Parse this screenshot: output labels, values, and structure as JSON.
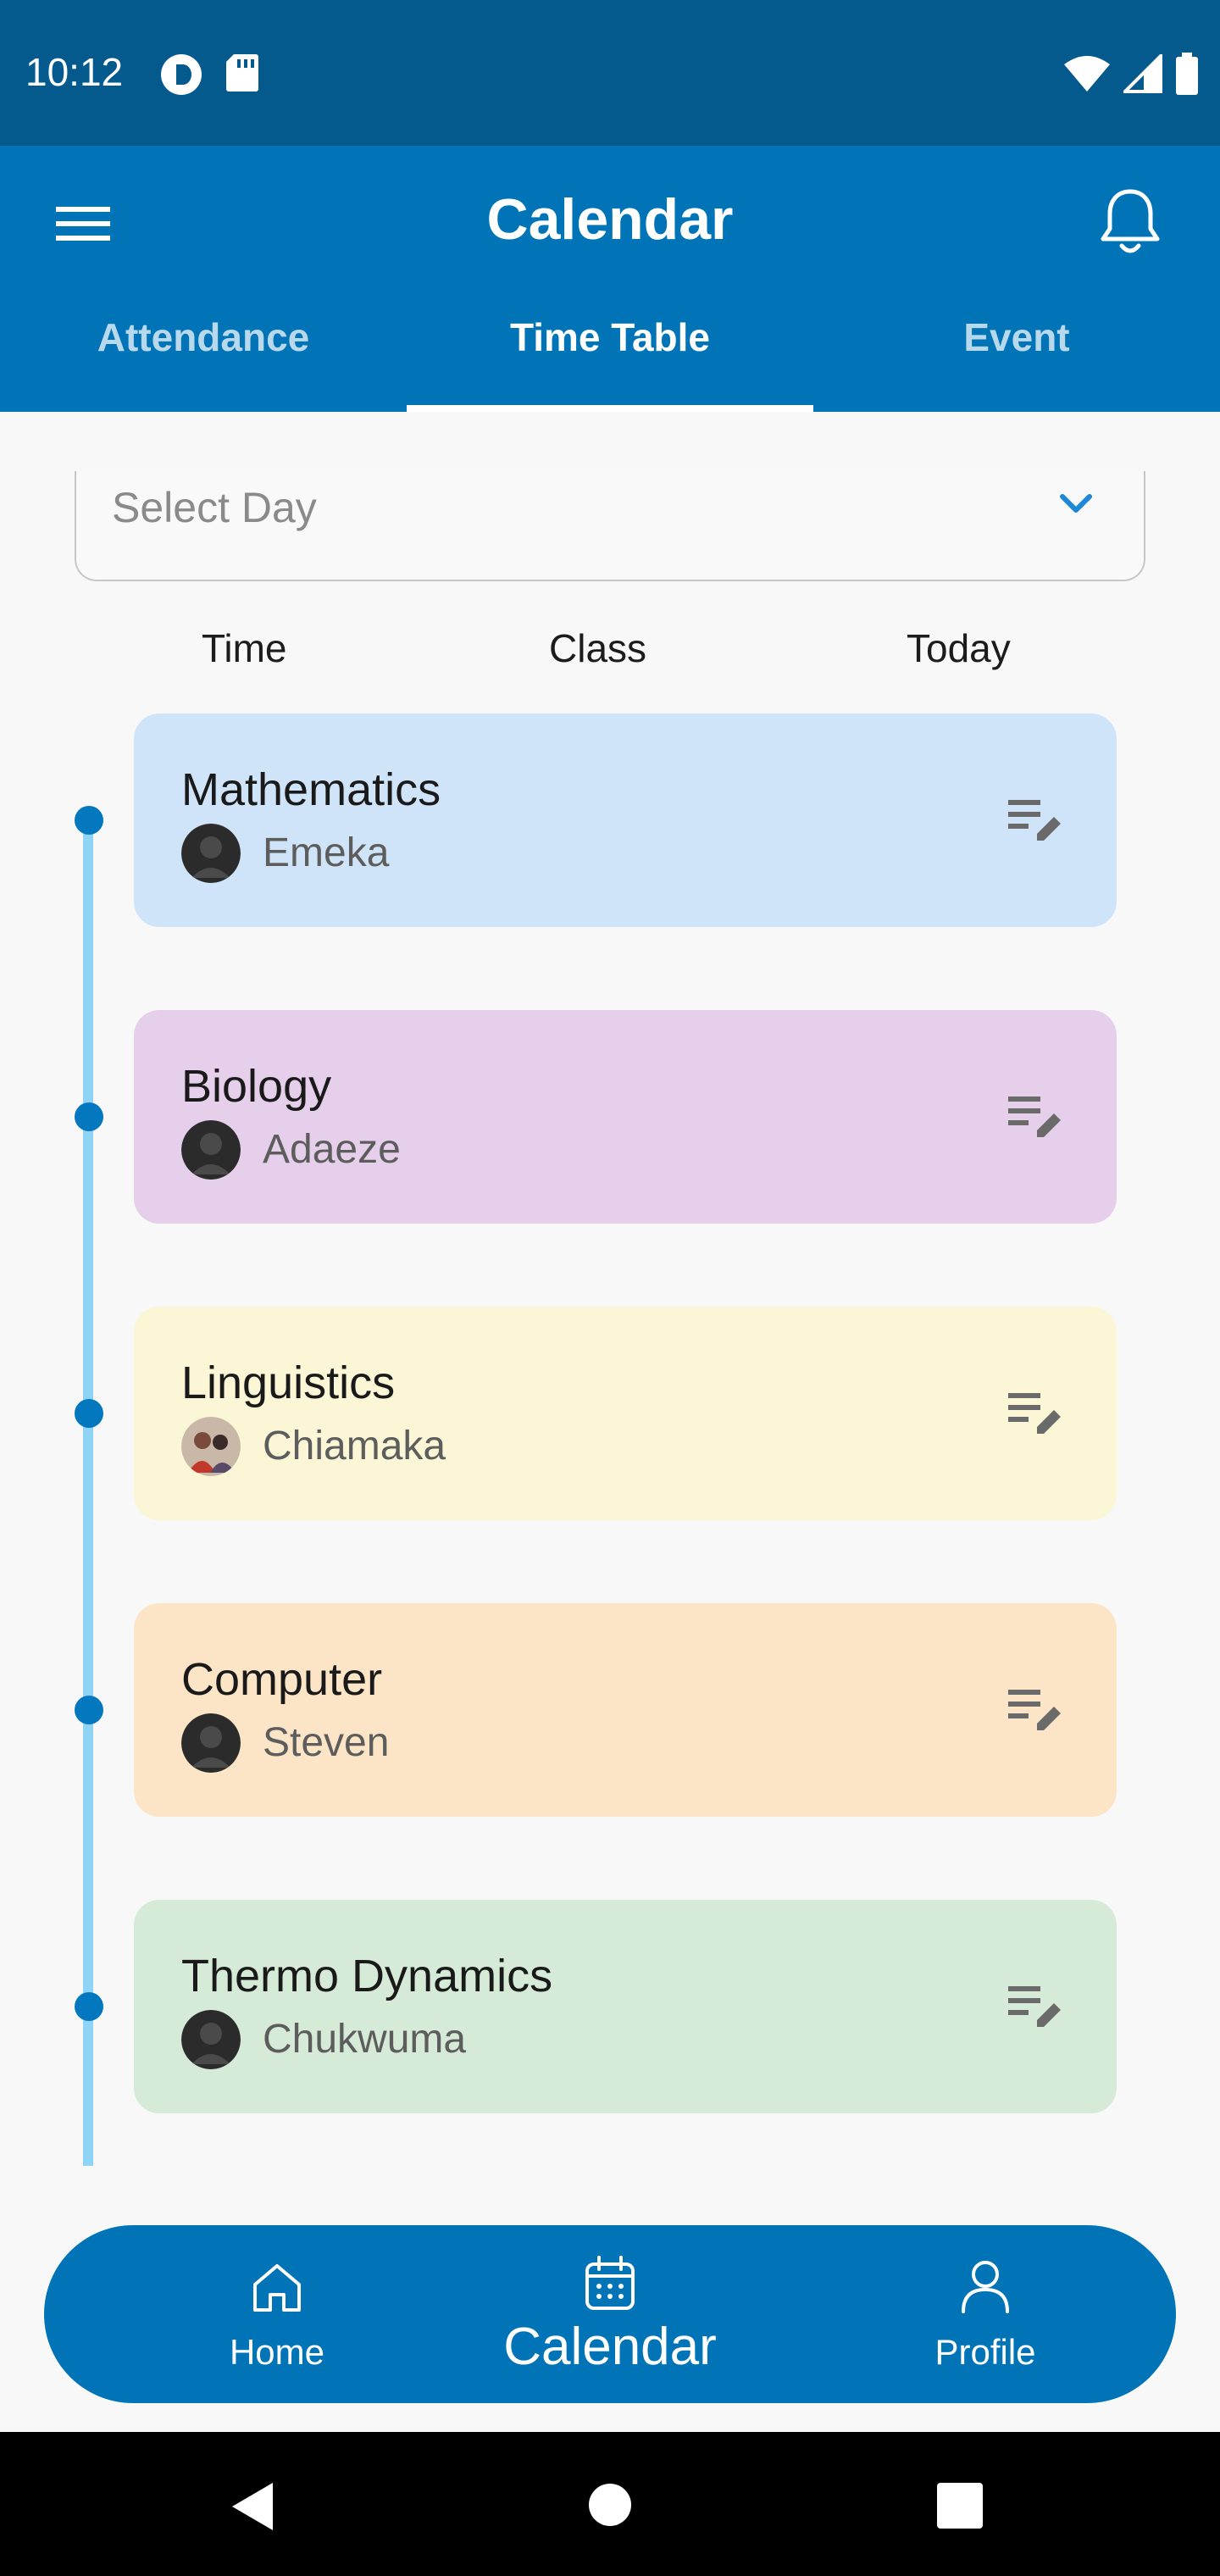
{
  "status_bar": {
    "time": "10:12"
  },
  "app_bar": {
    "title": "Calendar"
  },
  "tabs": [
    {
      "label": "Attendance",
      "active": false
    },
    {
      "label": "Time Table",
      "active": true
    },
    {
      "label": "Event",
      "active": false
    }
  ],
  "select_day": {
    "placeholder": "Select Day"
  },
  "columns": {
    "time": "Time",
    "class": "Class",
    "today": "Today"
  },
  "classes": [
    {
      "subject": "Mathematics",
      "teacher": "Emeka",
      "color": "#cfe4f8"
    },
    {
      "subject": "Biology",
      "teacher": "Adaeze",
      "color": "#e6cfeb"
    },
    {
      "subject": "Linguistics",
      "teacher": "Chiamaka",
      "color": "#fbf6d5"
    },
    {
      "subject": "Computer",
      "teacher": "Steven",
      "color": "#fce5c6"
    },
    {
      "subject": "Thermo Dynamics",
      "teacher": "Chukwuma",
      "color": "#d6ead8"
    }
  ],
  "bottom_nav": {
    "home": "Home",
    "calendar": "Calendar",
    "profile": "Profile"
  },
  "colors": {
    "primary": "#0174b8",
    "status_bar": "#045a8c",
    "timeline_dot": "#0478bf",
    "timeline_line": "#8fd4f5"
  },
  "icons": [
    "menu-icon",
    "bell-icon",
    "chevron-down-icon",
    "edit-note-icon",
    "home-icon",
    "calendar-icon",
    "profile-icon",
    "back-icon",
    "home-circle-icon",
    "recents-icon"
  ]
}
